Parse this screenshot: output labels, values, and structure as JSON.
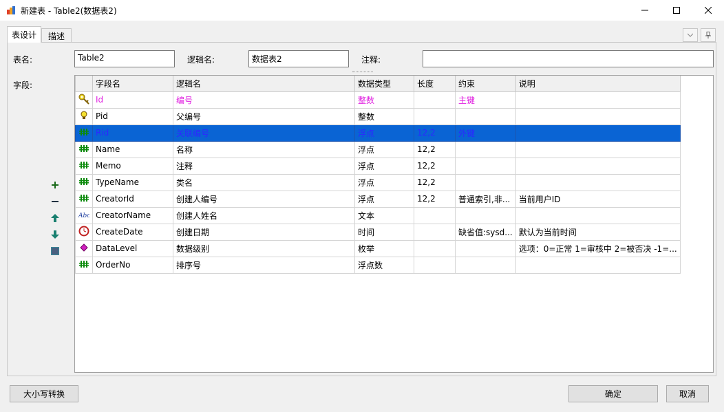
{
  "window": {
    "title": "新建表 - Table2(数据表2)"
  },
  "tabs": [
    {
      "label": "表设计"
    },
    {
      "label": "描述"
    }
  ],
  "form": {
    "table_name_label": "表名:",
    "table_name_value": "Table2",
    "logic_name_label": "逻辑名:",
    "logic_name_value": "数据表2",
    "comment_label": "注释:",
    "comment_value": "",
    "fields_label": "字段:"
  },
  "grid": {
    "columns": [
      "",
      "字段名",
      "逻辑名",
      "数据类型",
      "长度",
      "约束",
      "说明"
    ],
    "rows": [
      {
        "icon": "key-icon",
        "name": "Id",
        "logic": "编号",
        "type": "整数",
        "length": "",
        "constraint": "主键",
        "desc": ""
      },
      {
        "icon": "bulb-icon",
        "name": "Pid",
        "logic": "父编号",
        "type": "整数",
        "length": "",
        "constraint": "",
        "desc": ""
      },
      {
        "icon": "number-icon",
        "name": "Rid",
        "logic": "关联编号",
        "type": "浮点",
        "length": "12,2",
        "constraint": "外键",
        "desc": ""
      },
      {
        "icon": "number-icon",
        "name": "Name",
        "logic": "名称",
        "type": "浮点",
        "length": "12,2",
        "constraint": "",
        "desc": ""
      },
      {
        "icon": "number-icon",
        "name": "Memo",
        "logic": "注释",
        "type": "浮点",
        "length": "12,2",
        "constraint": "",
        "desc": ""
      },
      {
        "icon": "number-icon",
        "name": "TypeName",
        "logic": "类名",
        "type": "浮点",
        "length": "12,2",
        "constraint": "",
        "desc": ""
      },
      {
        "icon": "number-icon",
        "name": "CreatorId",
        "logic": "创建人编号",
        "type": "浮点",
        "length": "12,2",
        "constraint": "普通索引,非...",
        "desc": "当前用户ID"
      },
      {
        "icon": "text-icon",
        "name": "CreatorName",
        "logic": "创建人姓名",
        "type": "文本",
        "length": "",
        "constraint": "",
        "desc": ""
      },
      {
        "icon": "clock-icon",
        "name": "CreateDate",
        "logic": "创建日期",
        "type": "时间",
        "length": "",
        "constraint": "缺省值:sysd...",
        "desc": "默认为当前时间"
      },
      {
        "icon": "diamond-icon",
        "name": "DataLevel",
        "logic": "数据级别",
        "type": "枚举",
        "length": "",
        "constraint": "",
        "desc": "选项：0=正常 1=审核中 2=被否决 -1=..."
      },
      {
        "icon": "number-icon",
        "name": "OrderNo",
        "logic": "排序号",
        "type": "浮点数",
        "length": "",
        "constraint": "",
        "desc": ""
      }
    ]
  },
  "buttons": {
    "case_convert": "大小写转换",
    "ok": "确定",
    "cancel": "取消"
  },
  "colors": {
    "selection": "#0a64d4",
    "pk_text": "#e020e0",
    "selected_text": "#2c28ff",
    "number_icon": "#0a8a0a"
  }
}
